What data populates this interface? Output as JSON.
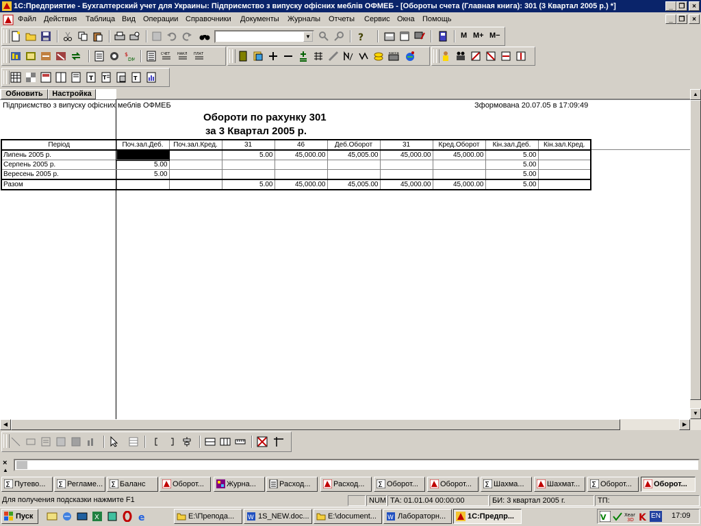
{
  "window": {
    "title": "1С:Предприятие - Бухгалтерский учет для Украины: Підприємство з випуску офісних меблів ОФМЕБ - [Обороты счета (Главная книга): 301 (3 Квартал 2005 р.) *]"
  },
  "menu": [
    "Файл",
    "Действия",
    "Таблица",
    "Вид",
    "Операции",
    "Справочники",
    "Документы",
    "Журналы",
    "Отчеты",
    "Сервис",
    "Окна",
    "Помощь"
  ],
  "toolbar": {
    "memory_buttons": [
      "M",
      "M+",
      "M−"
    ],
    "combo_value": ""
  },
  "report_buttons": {
    "refresh": "Обновить",
    "settings": "Настройка"
  },
  "report": {
    "company": "Підприємство з випуску офісних меблів ОФМЕБ",
    "generated": "Зформована 20.07.05 в 17:09:49",
    "title": "Обороти по рахунку 301",
    "subtitle": "за 3 Квартал 2005 р.",
    "columns": [
      "Період",
      "Поч.зал.Деб.",
      "Поч.зал.Кред.",
      "31",
      "46",
      "Деб.Оборот",
      "31",
      "Кред.Оборот",
      "Кін.зал.Деб.",
      "Кін.зал.Кред."
    ],
    "rows": [
      [
        "Липень 2005 р.",
        "",
        "",
        "5.00",
        "45,000.00",
        "45,005.00",
        "45,000.00",
        "45,000.00",
        "5.00",
        ""
      ],
      [
        "Серпень 2005 р.",
        "5.00",
        "",
        "",
        "",
        "",
        "",
        "",
        "5.00",
        ""
      ],
      [
        "Вересень 2005 р.",
        "5.00",
        "",
        "",
        "",
        "",
        "",
        "",
        "5.00",
        ""
      ]
    ],
    "total": [
      "Разом",
      "",
      "",
      "5.00",
      "45,000.00",
      "45,005.00",
      "45,000.00",
      "45,000.00",
      "5.00",
      ""
    ]
  },
  "window_tabs": [
    "Путево...",
    "Регламе...",
    "Баланс",
    "Оборот...",
    "Журна...",
    "Расход...",
    "Расход...",
    "Оборот...",
    "Оборот...",
    "Шахма...",
    "Шахмат...",
    "Оборот...",
    "Оборот..."
  ],
  "status": {
    "hint": "Для получения подсказки нажмите F1",
    "num": "NUM",
    "ta": "ТА: 01.01.04  00:00:00",
    "bi": "БИ: 3 квартал 2005 г.",
    "tp": "ТП:"
  },
  "taskbar": {
    "start": "Пуск",
    "tasks": [
      "E:\\Препода...",
      "1S_NEW.doc...",
      "E:\\document...",
      "Лабораторн...",
      "1С:Предпр..."
    ],
    "clock": "17:09",
    "lang": "EN"
  },
  "colors": {
    "title_bg": "#0a246a",
    "face": "#d4d0c8",
    "report_bg": "#ffffff"
  }
}
